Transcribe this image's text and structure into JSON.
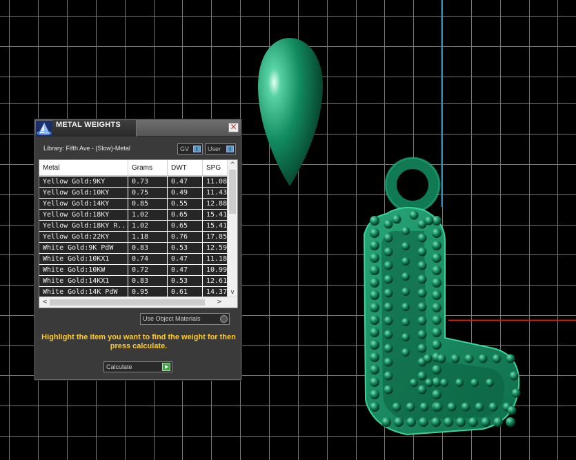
{
  "panel": {
    "title": "METAL WEIGHTS",
    "close_glyph": "✕",
    "library_label": "Library: Fifth Ave - (Slow)-Metal",
    "gv_toggle": "GV",
    "user_toggle": "User",
    "toggle_glyph": "I",
    "use_object_materials": "Use Object Materials",
    "instructions": "Highlight the item you want to find the weight for then press calculate.",
    "calculate": "Calculate",
    "scroll_up": "^",
    "scroll_down": "v",
    "scroll_left": "<",
    "scroll_right": ">"
  },
  "table": {
    "columns": [
      "Metal",
      "Grams",
      "DWT",
      "SPG"
    ],
    "rows": [
      [
        "Yellow Gold:9KY",
        "0.73",
        "0.47",
        "11.08"
      ],
      [
        "Yellow Gold:10KY",
        "0.75",
        "0.49",
        "11.43"
      ],
      [
        "Yellow Gold:14KY",
        "0.85",
        "0.55",
        "12.88"
      ],
      [
        "Yellow Gold:18KY",
        "1.02",
        "0.65",
        "15.41"
      ],
      [
        "Yellow Gold:18KY R...",
        "1.02",
        "0.65",
        "15.41"
      ],
      [
        "Yellow Gold:22KY",
        "1.18",
        "0.76",
        "17.85"
      ],
      [
        "White Gold:9K PdW",
        "0.83",
        "0.53",
        "12.59"
      ],
      [
        "White Gold:10KX1",
        "0.74",
        "0.47",
        "11.18"
      ],
      [
        "White Gold:10KW",
        "0.72",
        "0.47",
        "10.99"
      ],
      [
        "White Gold:14KX1",
        "0.83",
        "0.53",
        "12.61"
      ],
      [
        "White Gold:14K PdW",
        "0.95",
        "0.61",
        "14.37"
      ]
    ]
  },
  "colors": {
    "viewport_bg": "#000000",
    "grid": "#8c8c8c",
    "axis_x": "#cc2222",
    "axis_y": "#2a8fb8",
    "model": "#128a5f",
    "instructions": "#ffcb2c"
  },
  "icons": {
    "app_logo": "pyramid-logo-icon",
    "close": "close-icon",
    "calculate": "play-arrow-icon"
  }
}
